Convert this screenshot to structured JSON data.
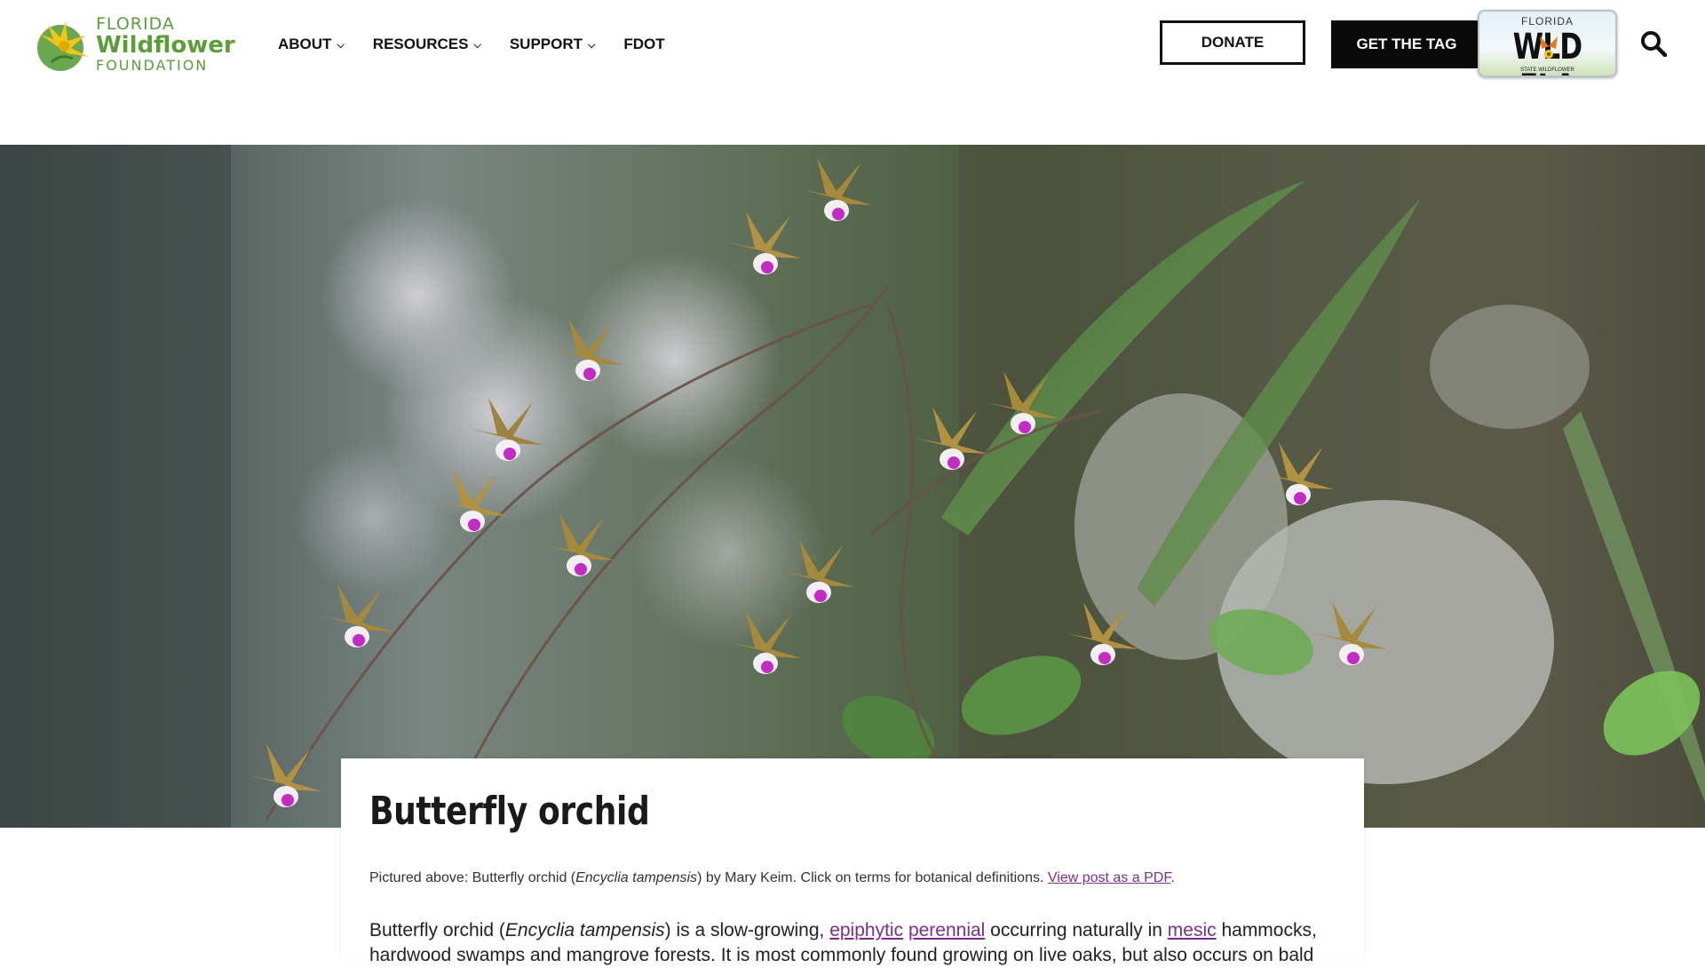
{
  "logo": {
    "line1": "FLORIDA",
    "line2": "Wildflower",
    "line3": "FOUNDATION",
    "brand_color": "#5a9e3a",
    "icon": "wildflower-logo-icon"
  },
  "nav": {
    "items": [
      {
        "label": "ABOUT",
        "has_dropdown": true
      },
      {
        "label": "RESOURCES",
        "has_dropdown": true
      },
      {
        "label": "SUPPORT",
        "has_dropdown": true
      },
      {
        "label": "FDOT",
        "has_dropdown": false
      }
    ],
    "chevron": "⌵"
  },
  "actions": {
    "donate_label": "DONATE",
    "tag_label": "GET THE TAG",
    "search_icon": "search-icon"
  },
  "plate": {
    "state": "FLORIDA",
    "number": "WLD FLA",
    "subtitle": "STATE WILDFLOWER"
  },
  "article": {
    "title": "Butterfly orchid",
    "caption": {
      "prefix": "Pictured above: Butterfly orchid (",
      "species": "Encyclia tampensis",
      "suffix": ") by Mary Keim. Click on terms for botanical definitions. ",
      "pdf_link": "View post as a PDF",
      "end": "."
    },
    "body": {
      "part1": "Butterfly orchid (",
      "species": "Encyclia tampensis",
      "part2": ") is a slow-growing, ",
      "link1": "epiphytic",
      "link2": "perennial",
      "part3": " occurring naturally in ",
      "link3": "mesic",
      "part4": " hammocks,",
      "line2": "hardwood swamps and mangrove forests. It is most commonly found growing on live oaks, but also occurs on bald"
    }
  },
  "colors": {
    "link": "#7b2e8e",
    "button_dark": "#0a0a0a"
  }
}
